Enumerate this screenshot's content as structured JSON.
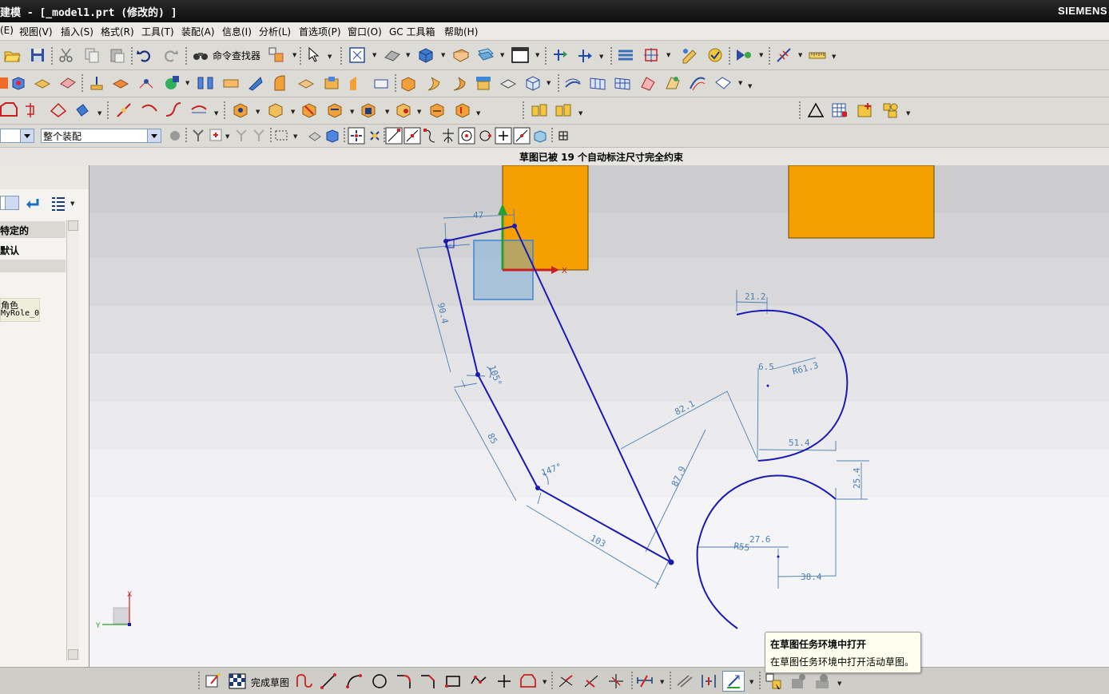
{
  "window": {
    "title": "建模 - [_model1.prt (修改的) ]",
    "brand": "SIEMENS"
  },
  "menu": {
    "items": [
      "(E)",
      "视图(V)",
      "插入(S)",
      "格式(R)",
      "工具(T)",
      "装配(A)",
      "信息(I)",
      "分析(L)",
      "首选项(P)",
      "窗口(O)",
      "GC 工具箱",
      "帮助(H)"
    ]
  },
  "toolbar1": {
    "command_finder_label": "命令查找器"
  },
  "toolbar4": {
    "filter_value": "",
    "scope_value": "整个装配"
  },
  "cue_line": {
    "message": "草图已被 19 个自动标注尺寸完全约束"
  },
  "left_panel": {
    "row1": "特定的",
    "row2": "默认",
    "role_line1": "角色",
    "role_line2": "MyRole_0"
  },
  "sketch": {
    "dimensions": [
      "47",
      "90.4",
      "105°",
      "85",
      "147°",
      "103",
      "82.1",
      "87.9",
      "21.2",
      "6.5",
      "R61.3",
      "51.4",
      "25.4",
      "27.6",
      "R55",
      "38.4"
    ],
    "csys_x": "X",
    "csys_y": "Y",
    "triad_x": "X",
    "triad_y": "Y"
  },
  "bottom_toolbar": {
    "finish_sketch_label": "完成草图"
  },
  "tooltip": {
    "title": "在草图任务环境中打开",
    "body": "在草图任务环境中打开活动草图。"
  },
  "colors": {
    "orange_block": "#f5a000",
    "sketch_curve": "#1a1ab3",
    "dimension": "#4a7fb5",
    "title_bar": "#1a1a1a"
  }
}
